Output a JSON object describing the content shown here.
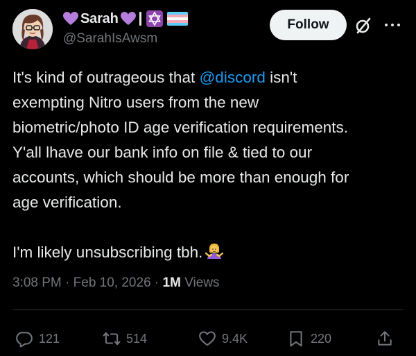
{
  "author": {
    "display_name": "Sarah",
    "handle": "@SarahIsAwsm",
    "badge_icons": [
      "purple-heart-icon",
      "purple-heart-icon",
      "star-of-david-icon",
      "transgender-flag-icon"
    ]
  },
  "follow_label": "Follow",
  "tweet": {
    "lines": [
      {
        "before": "It's kind of outrageous that ",
        "mention": "@discord",
        "after": " isn't"
      },
      {
        "text": "exempting Nitro users from the new"
      },
      {
        "text": "biometric/photo ID age verification requirements."
      },
      {
        "text": "Y'all lhave our bank info on file & tied to our"
      },
      {
        "text": "accounts, which should be more than enough for"
      },
      {
        "text": "age verification."
      },
      {
        "text": "I'm likely unsubscribing tbh."
      }
    ],
    "emoji": "person-shrugging-icon"
  },
  "meta": {
    "time": "3:08 PM",
    "date": "Feb 10, 2026",
    "views_count": "1M",
    "views_label": "Views"
  },
  "actions": {
    "replies": "121",
    "reposts": "514",
    "likes": "9.4K",
    "bookmarks": "220"
  },
  "colors": {
    "background": "#000000",
    "text": "#e7e9ea",
    "secondary": "#71767b",
    "mention": "#1d9bf0",
    "heart": "#b57edc"
  }
}
